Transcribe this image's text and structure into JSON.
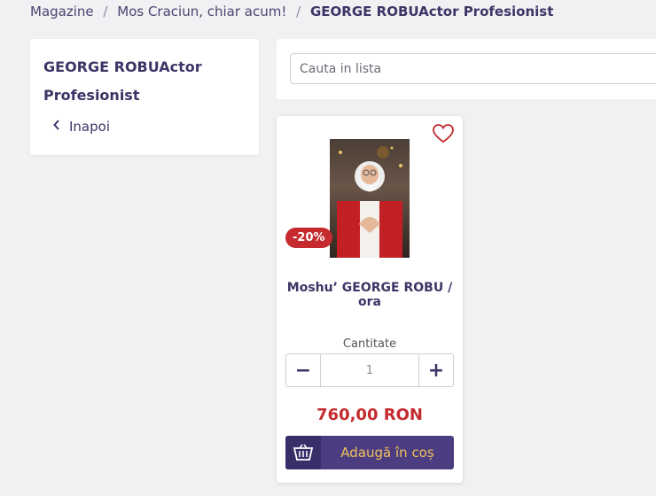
{
  "breadcrumb": {
    "items": [
      "Magazine",
      "Mos Craciun, chiar acum!"
    ],
    "separator": "/",
    "current": "GEORGE ROBUActor Profesionist"
  },
  "sidebar": {
    "title": "GEORGE ROBUActor Profesionist",
    "back_label": "Inapoi"
  },
  "search": {
    "placeholder": "Cauta in lista"
  },
  "product": {
    "discount": "-20%",
    "name": "Moshu’ GEORGE ROBU / ora",
    "quantity_label": "Cantitate",
    "quantity_value": "1",
    "minus_label": "−",
    "plus_label": "+",
    "price": "760,00 RON",
    "add_to_cart_label": "Adaugă în coș"
  },
  "colors": {
    "accent": "#4c3d82",
    "price": "#c42a2e",
    "button_text": "#f0c15a"
  },
  "icons": {
    "wishlist": "heart-icon",
    "back": "chevron-left-icon",
    "cart": "basket-icon"
  }
}
